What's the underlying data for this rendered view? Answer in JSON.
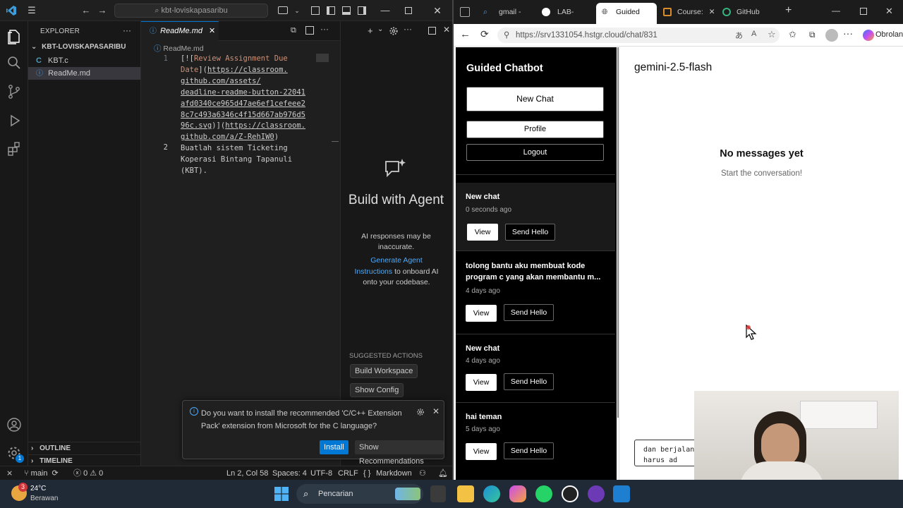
{
  "vscode": {
    "search": "kbt-loviskapasaribu",
    "explorer_title": "EXPLORER",
    "folder": "KBT-LOVISKAPASARIBU",
    "files": [
      "KBT.c",
      "ReadMe.md"
    ],
    "tab_label": "ReadMe.md",
    "breadcrumb": "ReadMe.md",
    "code": {
      "line1": [
        "[![",
        "Review Assignment Due",
        "Date",
        "](",
        "https://classroom.",
        "github.com/assets/",
        "deadline-readme-button-22041",
        "afd0340ce965d47ae6ef1cefeee2",
        "8c7c493a6346c4f15d667ab976d5",
        "96c.svg",
        ")](",
        "https://classroom.",
        "github.com/a/Z-RehIW0",
        ")"
      ],
      "line2": [
        "Buatlah sistem Ticketing",
        "Koperasi Bintang Tapanuli",
        "(KBT)."
      ],
      "line_numbers": [
        "1",
        "2"
      ]
    },
    "chat": {
      "heading": "Build with Agent",
      "disclaimer": "AI responses may be inaccurate.",
      "link": "Generate Agent Instructions",
      "link_suffix": " to onboard AI onto your codebase.",
      "suggested": "SUGGESTED ACTIONS",
      "actions": [
        "Build Workspace",
        "Show Config"
      ]
    },
    "notification": {
      "text": "Do you want to install the recommended 'C/C++ Extension Pack' extension from Microsoft for the C language?",
      "install": "Install",
      "show": "Show Recommendations"
    },
    "outline": "OUTLINE",
    "timeline": "TIMELINE",
    "status": {
      "branch": "main",
      "problems": "0",
      "warnings": "0",
      "position": "Ln 2, Col 58",
      "spaces": "Spaces: 4",
      "encoding": "UTF-8",
      "eol": "CRLF",
      "lang_brace": "{ }",
      "language": "Markdown"
    }
  },
  "browser": {
    "tabs": [
      "gmail - M",
      "LAB-TAS",
      "Guided C",
      "Course:",
      "GitHub C"
    ],
    "url": "https://srv1331054.hstgr.cloud/chat/831",
    "profile": "Obrolan",
    "app": {
      "brand": "Guided Chatbot",
      "new_chat": "New Chat",
      "profile": "Profile",
      "logout": "Logout",
      "conversations": [
        {
          "title": "New chat",
          "time": "0 seconds ago"
        },
        {
          "title": "tolong bantu aku membuat kode program c yang akan membantu m...",
          "time": "4 days ago"
        },
        {
          "title": "New chat",
          "time": "4 days ago"
        },
        {
          "title": "hai teman",
          "time": "5 days ago"
        }
      ],
      "view_label": "View",
      "hello_label": "Send Hello",
      "model": "gemini-2.5-flash",
      "empty_title": "No messages yet",
      "empty_sub": "Start the conversation!",
      "input_lines": [
        "dan berjalan",
        "harus ad"
      ]
    }
  },
  "taskbar": {
    "temp": "24°C",
    "weather": "Berawan",
    "badge": "3",
    "search": "Pencarian"
  }
}
